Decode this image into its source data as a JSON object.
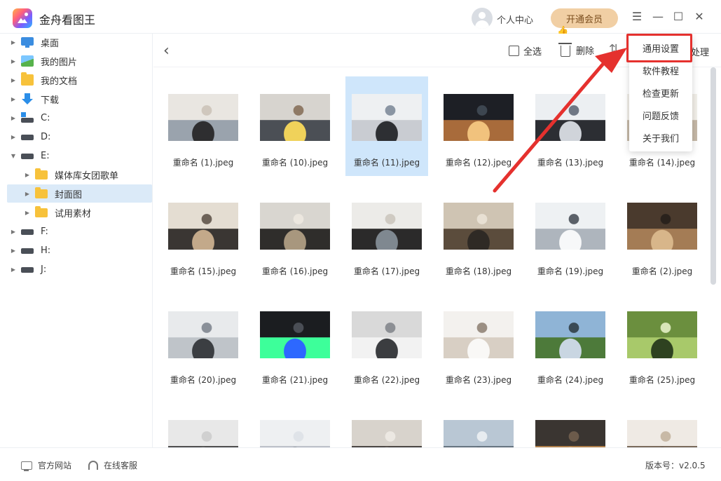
{
  "app": {
    "title": "金舟看图王"
  },
  "header": {
    "user_center": "个人中心",
    "vip_button": "开通会员",
    "menu_icon": "hamburger-icon",
    "minimize_icon": "minimize-icon",
    "maximize_icon": "maximize-icon",
    "close_icon": "close-icon"
  },
  "sidebar": {
    "items": [
      {
        "label": "桌面",
        "icon": "desktop-icon"
      },
      {
        "label": "我的图片",
        "icon": "pictures-icon"
      },
      {
        "label": "我的文档",
        "icon": "documents-icon"
      },
      {
        "label": "下载",
        "icon": "download-icon"
      },
      {
        "label": "C:",
        "icon": "drive-icon"
      },
      {
        "label": "D:",
        "icon": "drive-icon"
      },
      {
        "label": "E:",
        "icon": "drive-icon"
      },
      {
        "label": "媒体库女团歌单",
        "icon": "folder-icon"
      },
      {
        "label": "封面图",
        "icon": "folder-icon"
      },
      {
        "label": "试用素材",
        "icon": "folder-icon"
      },
      {
        "label": "F:",
        "icon": "drive-icon"
      },
      {
        "label": "H:",
        "icon": "drive-icon"
      },
      {
        "label": "J:",
        "icon": "drive-icon"
      }
    ]
  },
  "toolbar": {
    "select_all": "全选",
    "delete": "删除",
    "process": "处理"
  },
  "menu": {
    "items": [
      "通用设置",
      "软件教程",
      "检查更新",
      "问题反馈",
      "关于我们"
    ],
    "highlighted": "通用设置",
    "highlight_color": "#e5312e"
  },
  "files": [
    "重命名 (1).jpeg",
    "重命名 (10).jpeg",
    "重命名 (11).jpeg",
    "重命名 (12).jpeg",
    "重命名 (13).jpeg",
    "重命名 (14).jpeg",
    "重命名 (15).jpeg",
    "重命名 (16).jpeg",
    "重命名 (17).jpeg",
    "重命名 (18).jpeg",
    "重命名 (19).jpeg",
    "重命名 (2).jpeg",
    "重命名 (20).jpeg",
    "重命名 (21).jpeg",
    "重命名 (22).jpeg",
    "重命名 (23).jpeg",
    "重命名 (24).jpeg",
    "重命名 (25).jpeg",
    "",
    "",
    "",
    "",
    "",
    ""
  ],
  "selected_file": "重命名 (11).jpeg",
  "footer": {
    "official_site": "官方网站",
    "online_service": "在线客服",
    "version": "版本号：v2.0.5"
  },
  "colors": {
    "vip_bg": "#f1cfa4",
    "selected_bg": "#cfe6fb",
    "sidebar_selected_bg": "#dbeaf8",
    "annotation_red": "#e5312e"
  }
}
